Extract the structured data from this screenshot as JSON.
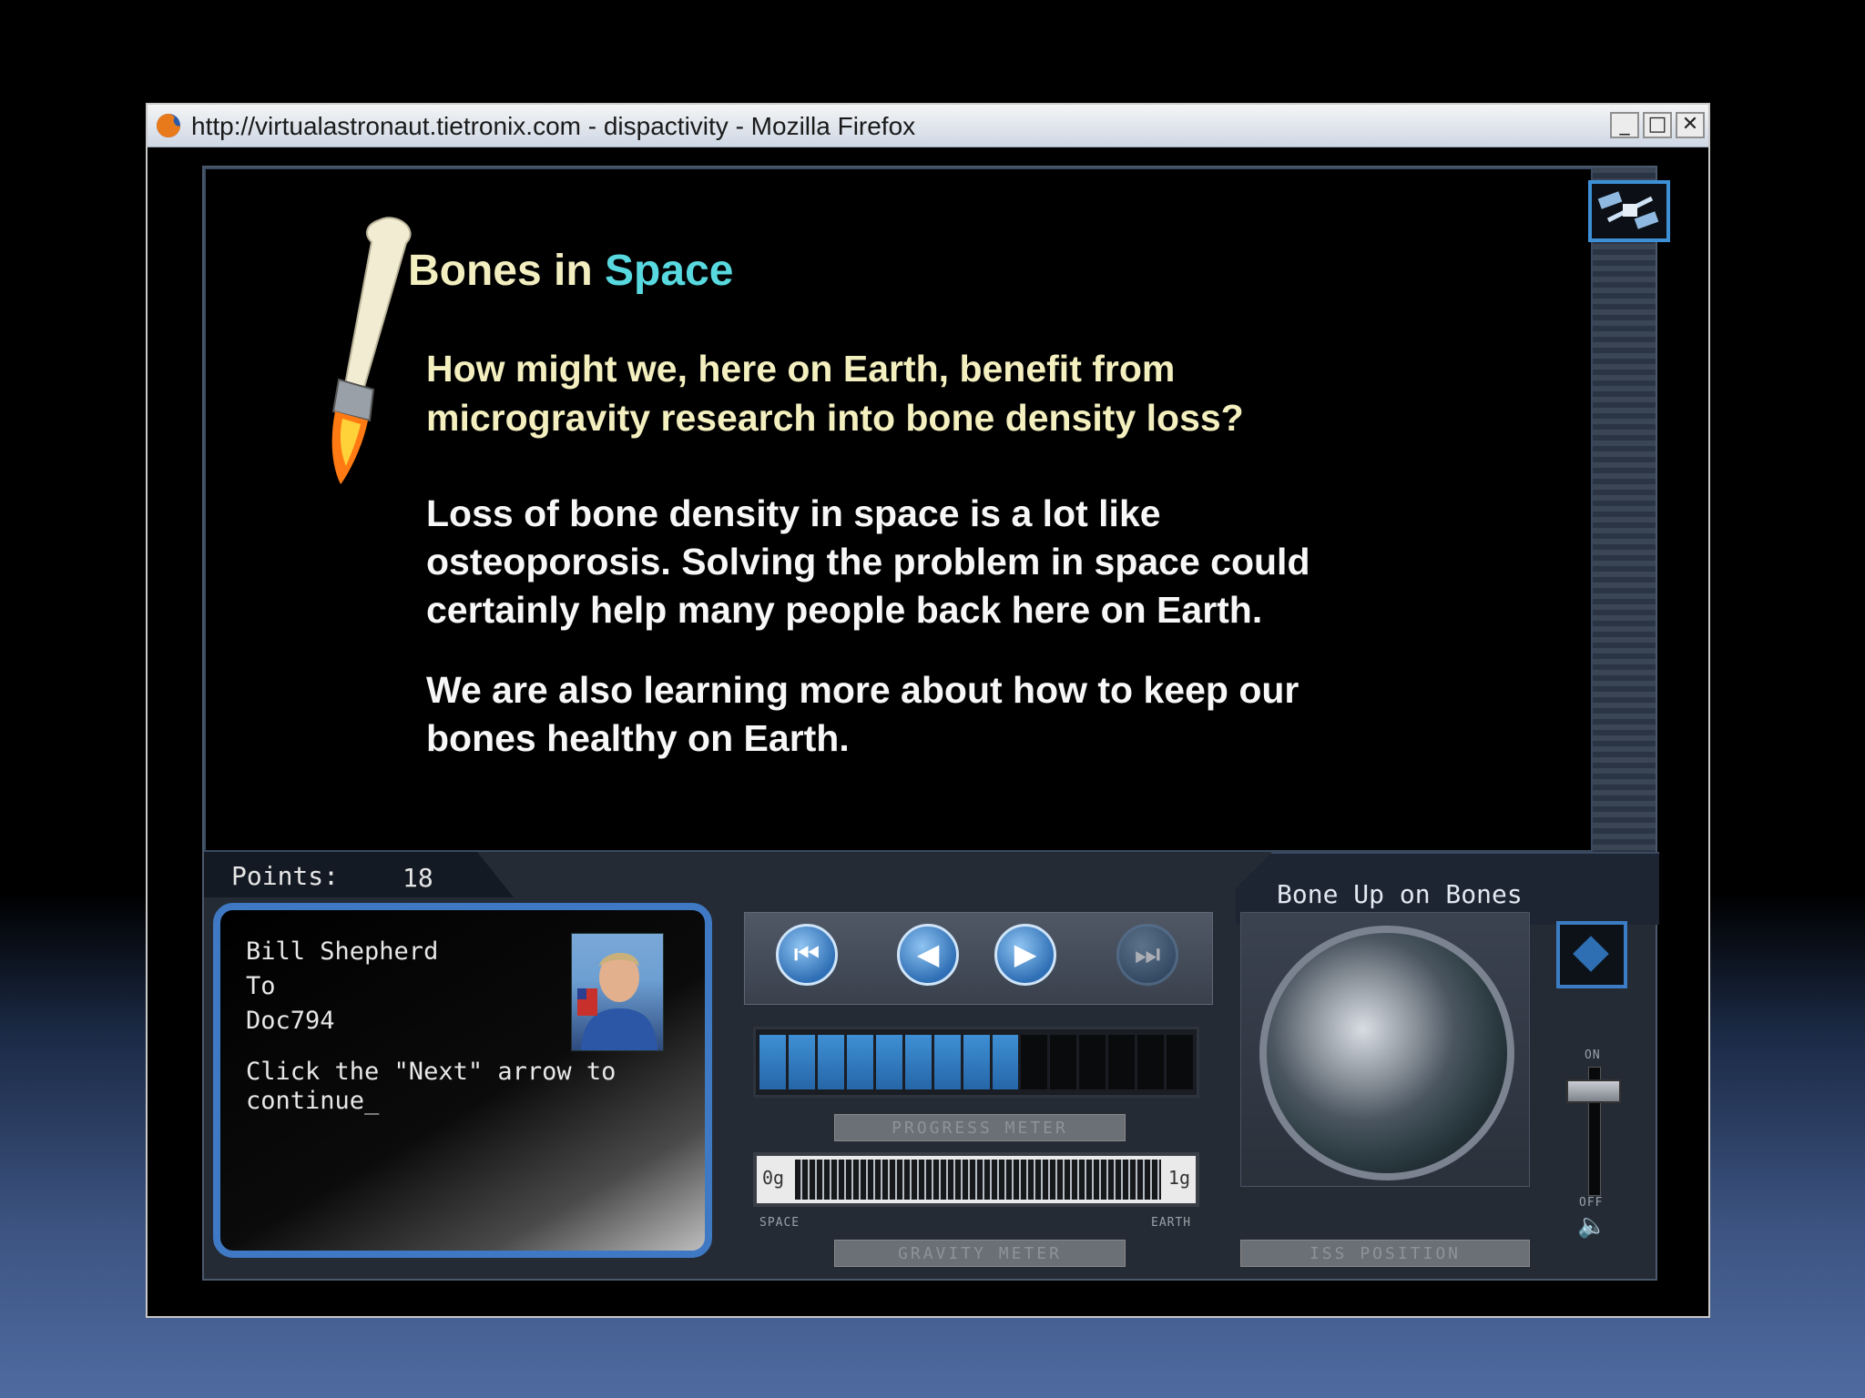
{
  "browser": {
    "title": "http://virtualastronaut.tietronix.com - dispactivity - Mozilla Firefox",
    "buttons": {
      "minimize": "_",
      "maximize": "□",
      "close": "✕"
    }
  },
  "content": {
    "heading_part1": "Bones in ",
    "heading_part2": "Space",
    "question": "How might we, here on Earth, benefit from microgravity research into bone density loss?",
    "paragraph1": "Loss of bone density in space is a lot like osteoporosis. Solving the problem in space could certainly help many people back here on Earth.",
    "paragraph2": "We are also learning more about how to keep our bones healthy on Earth."
  },
  "points": {
    "label": "Points:",
    "value": "18"
  },
  "mission": {
    "name": "Bone Up on Bones"
  },
  "message": {
    "from": "Bill Shepherd",
    "to_label": "To",
    "to": "Doc794",
    "body_line1": "Click the \"Next\" arrow to",
    "body_line2": "continue_"
  },
  "nav": {
    "first": "⏮",
    "back": "◀",
    "next": "▶",
    "last": "⏭"
  },
  "progress": {
    "label": "PROGRESS METER",
    "filled_segments": 9,
    "total_segments": 15
  },
  "gravity": {
    "label": "GRAVITY METER",
    "min_label": "0g",
    "max_label": "1g",
    "left_caption": "SPACE",
    "right_caption": "EARTH"
  },
  "iss": {
    "label": "ISS POSITION"
  },
  "volume": {
    "on_label": "ON",
    "off_label": "OFF"
  },
  "icons": {
    "firefox": "firefox-icon",
    "iss": "iss-station-icon",
    "bone": "bone-rocket-icon",
    "speaker": "speaker-icon"
  }
}
